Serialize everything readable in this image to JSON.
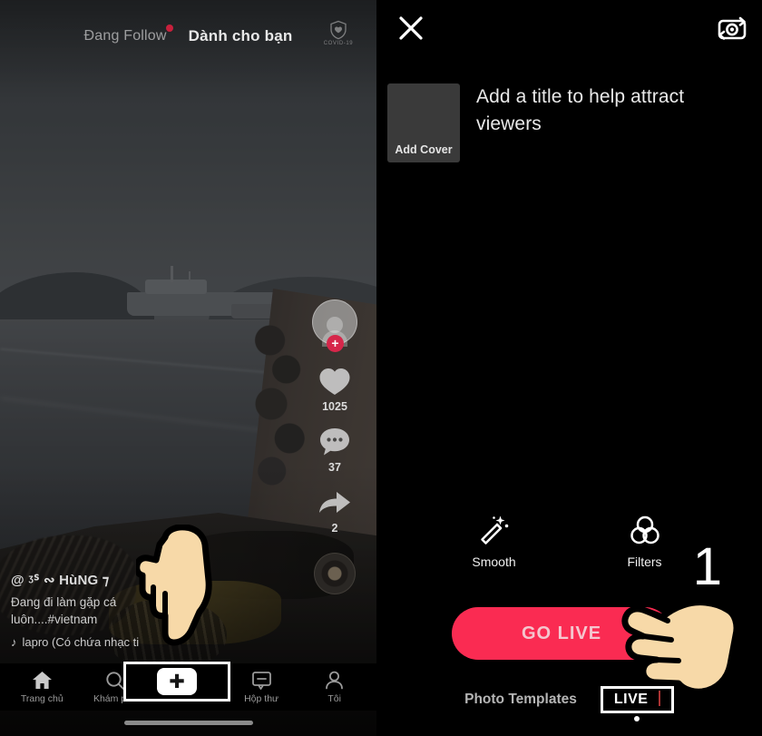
{
  "left_panel": {
    "tabs": {
      "following_label": "Đang Follow",
      "foryou_label": "Dành cho bạn",
      "has_notification_dot": true
    },
    "covid_badge": {
      "label": "COVID-19",
      "icon": "shield-heart-icon"
    },
    "action_rail": {
      "avatar_icon": "user-avatar",
      "follow_button": "+",
      "like_count": "1025",
      "comment_count": "37",
      "share_count": "2",
      "music_disc_icon": "music-disc-icon"
    },
    "caption": {
      "username": "@ ᶾᔆ ∾ HùNG ⁊ ",
      "text_line1": "Đang đi làm gặp cá",
      "text_line2": "luôn....#vietnam",
      "music_note_icon": "music-note-icon",
      "music": "lapro (Có chứa nhạc ti"
    },
    "bottom_nav": [
      {
        "label": "Trang chủ",
        "icon": "home-icon"
      },
      {
        "label": "Khám phá",
        "icon": "search-icon"
      },
      {
        "label": "",
        "icon": "plus-create-icon"
      },
      {
        "label": "Hộp thư",
        "icon": "inbox-icon"
      },
      {
        "label": "Tôi",
        "icon": "person-icon"
      }
    ]
  },
  "right_panel": {
    "close_icon": "close-icon",
    "flip_camera_icon": "flip-camera-icon",
    "cover": {
      "label": "Add Cover"
    },
    "title_placeholder": "Add a title to help attract viewers",
    "tools": [
      {
        "label": "Smooth",
        "icon": "magic-wand-icon"
      },
      {
        "label": "Filters",
        "icon": "filters-circles-icon"
      }
    ],
    "go_live_label": "GO LIVE",
    "modes": {
      "photo_templates_label": "Photo Templates",
      "live_label": "LIVE"
    },
    "step_number": "1"
  },
  "colors": {
    "accent_pink": "#fa2b52",
    "tiktok_cyan": "#25f4ee",
    "tiktok_red": "#fe2c55",
    "highlight_border": "#ffffff",
    "hand_skin": "#f7d9a8"
  }
}
